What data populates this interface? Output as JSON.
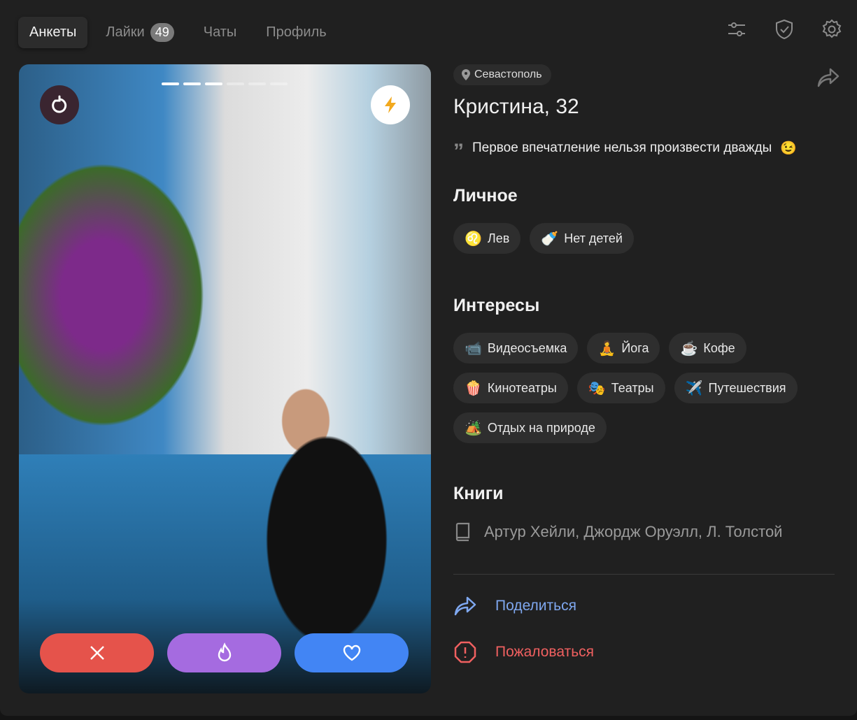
{
  "nav": {
    "tabs": [
      {
        "label": "Анкеты"
      },
      {
        "label": "Лайки",
        "badge": "49"
      },
      {
        "label": "Чаты"
      },
      {
        "label": "Профиль"
      }
    ]
  },
  "icons": [
    "filters-icon",
    "shield-check-icon",
    "gear-icon"
  ],
  "photo": {
    "count": 6,
    "current": 3
  },
  "profile": {
    "city": "Севастополь",
    "name": "Кристина, 32",
    "quote": "Первое впечатление нельзя произвести дважды",
    "quote_emoji": "😉"
  },
  "personal": {
    "title": "Личное",
    "items": [
      {
        "icon": "♌",
        "label": "Лев"
      },
      {
        "icon": "🍼",
        "label": "Нет детей"
      }
    ]
  },
  "interests": {
    "title": "Интересы",
    "items": [
      {
        "icon": "📹",
        "label": "Видеосъемка"
      },
      {
        "icon": "🧘",
        "label": "Йога"
      },
      {
        "icon": "☕",
        "label": "Кофе"
      },
      {
        "icon": "🍿",
        "label": "Кинотеатры"
      },
      {
        "icon": "🎭",
        "label": "Театры"
      },
      {
        "icon": "✈️",
        "label": "Путешествия"
      },
      {
        "icon": "🏕️",
        "label": "Отдых на природе"
      }
    ]
  },
  "books": {
    "title": "Книги",
    "text": "Артур Хейли, Джордж Оруэлл, Л. Толстой"
  },
  "links": {
    "share": "Поделиться",
    "report": "Пожаловаться"
  },
  "colors": {
    "dislike": "#e5534b",
    "superlike": "#a56be0",
    "like": "#4285f4",
    "share": "#7fa8f0",
    "report": "#f06060"
  }
}
